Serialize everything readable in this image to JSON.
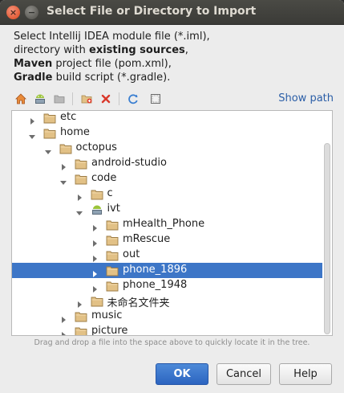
{
  "window": {
    "title": "Select File or Directory to Import"
  },
  "description": {
    "line1": "Select Intellij IDEA module file (*.iml),",
    "line2_prefix": "directory with ",
    "line2_bold": "existing sources",
    "line2_suffix": ",",
    "line3_bold": "Maven",
    "line3_rest": " project file (pom.xml),",
    "line4_bold": "Gradle",
    "line4_rest": " build script (*.gradle)."
  },
  "toolbar": {
    "icons": [
      "home-icon",
      "android-project-icon",
      "folder-icon",
      "new-folder-icon",
      "delete-icon",
      "refresh-icon",
      "show-hidden-icon"
    ],
    "show_path_label": "Show path"
  },
  "tree": {
    "items": [
      {
        "label": "etc",
        "expanded": false,
        "icon": "folder"
      },
      {
        "label": "home",
        "expanded": true,
        "icon": "folder"
      },
      {
        "label": "octopus",
        "expanded": true,
        "icon": "folder"
      },
      {
        "label": "android-studio",
        "expanded": false,
        "icon": "folder"
      },
      {
        "label": "code",
        "expanded": true,
        "icon": "folder"
      },
      {
        "label": "c",
        "expanded": false,
        "icon": "folder"
      },
      {
        "label": "ivt",
        "expanded": true,
        "icon": "android"
      },
      {
        "label": "mHealth_Phone",
        "expanded": false,
        "icon": "folder"
      },
      {
        "label": "mRescue",
        "expanded": false,
        "icon": "folder"
      },
      {
        "label": "out",
        "expanded": false,
        "icon": "folder"
      },
      {
        "label": "phone_1896",
        "expanded": false,
        "icon": "folder",
        "selected": true
      },
      {
        "label": "phone_1948",
        "expanded": false,
        "icon": "folder"
      },
      {
        "label": "未命名文件夹",
        "expanded": false,
        "icon": "folder"
      },
      {
        "label": "music",
        "expanded": false,
        "icon": "folder"
      },
      {
        "label": "picture",
        "expanded": false,
        "icon": "folder"
      }
    ]
  },
  "hint": "Drag and drop a file into the space above to quickly locate it in the tree.",
  "buttons": {
    "ok": "OK",
    "cancel": "Cancel",
    "help": "Help"
  },
  "colors": {
    "selection": "#3d76c7",
    "folder": "#e2c186",
    "link": "#2b5ea7",
    "ok_button": "#3a74cc",
    "title_bar": "#3f3f3b"
  }
}
